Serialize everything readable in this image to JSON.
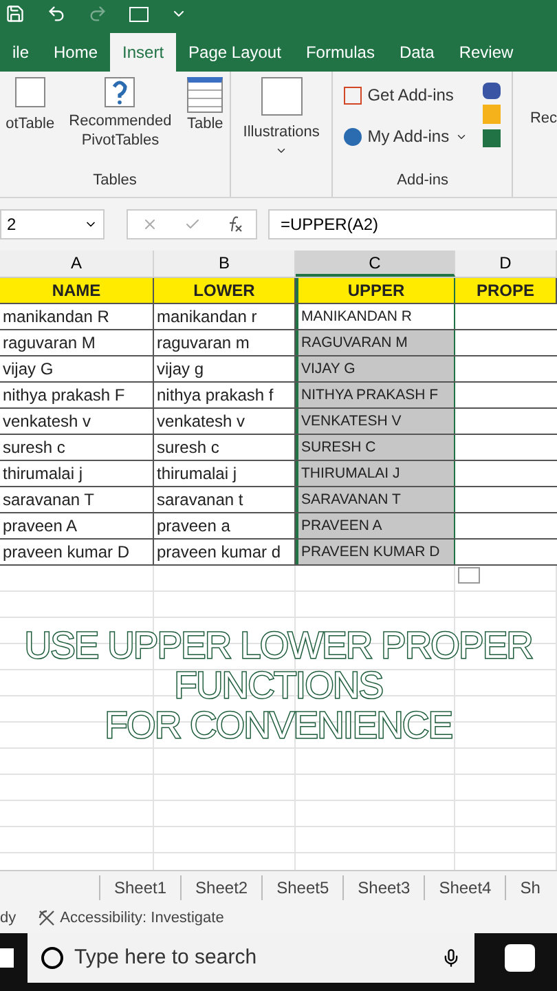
{
  "ribbon_tabs": [
    {
      "label": "ile",
      "selected": false
    },
    {
      "label": "Home",
      "selected": false
    },
    {
      "label": "Insert",
      "selected": true
    },
    {
      "label": "Page Layout",
      "selected": false
    },
    {
      "label": "Formulas",
      "selected": false
    },
    {
      "label": "Data",
      "selected": false
    },
    {
      "label": "Review",
      "selected": false
    }
  ],
  "ribbon": {
    "pivot": "otTable",
    "recommended": "Recommended PivotTables",
    "table": "Table",
    "tables_group": "Tables",
    "illustrations": "Illustrations",
    "get_addins": "Get Add-ins",
    "my_addins": "My Add-ins",
    "addins_group": "Add-ins",
    "cut": "Rec"
  },
  "formula_bar": {
    "name_box": "2",
    "formula": "=UPPER(A2)"
  },
  "columns": [
    {
      "label": "A",
      "selected": false
    },
    {
      "label": "B",
      "selected": false
    },
    {
      "label": "C",
      "selected": true
    },
    {
      "label": "D",
      "selected": false
    }
  ],
  "header_row": [
    "NAME",
    "LOWER",
    "UPPER",
    "PROPE"
  ],
  "rows": [
    {
      "name": "manikandan R",
      "lower": "manikandan r",
      "upper": "MANIKANDAN R",
      "selected": false
    },
    {
      "name": "raguvaran M",
      "lower": "raguvaran m",
      "upper": "RAGUVARAN M",
      "selected": true
    },
    {
      "name": "vijay G",
      "lower": "vijay g",
      "upper": "VIJAY G",
      "selected": true
    },
    {
      "name": "nithya prakash F",
      "lower": "nithya prakash f",
      "upper": "NITHYA PRAKASH F",
      "selected": true
    },
    {
      "name": "venkatesh v",
      "lower": "venkatesh v",
      "upper": "VENKATESH V",
      "selected": true
    },
    {
      "name": "suresh c",
      "lower": "suresh c",
      "upper": "SURESH C",
      "selected": true
    },
    {
      "name": "thirumalai j",
      "lower": "thirumalai j",
      "upper": "THIRUMALAI J",
      "selected": true
    },
    {
      "name": "saravanan T",
      "lower": "saravanan t",
      "upper": "SARAVANAN T",
      "selected": true
    },
    {
      "name": "praveen A",
      "lower": "praveen a",
      "upper": "PRAVEEN A",
      "selected": true
    },
    {
      "name": "praveen kumar D",
      "lower": "praveen kumar d",
      "upper": "PRAVEEN KUMAR D",
      "selected": true
    }
  ],
  "caption": [
    "USE UPPER LOWER PROPER",
    "FUNCTIONS",
    "FOR CONVENIENCE"
  ],
  "sheet_tabs": [
    "Sheet1",
    "Sheet2",
    "Sheet5",
    "Sheet3",
    "Sheet4",
    "Sh"
  ],
  "status_bar": {
    "mode": "dy",
    "accessibility": "Accessibility: Investigate"
  },
  "taskbar": {
    "search_placeholder": "Type here to search"
  }
}
